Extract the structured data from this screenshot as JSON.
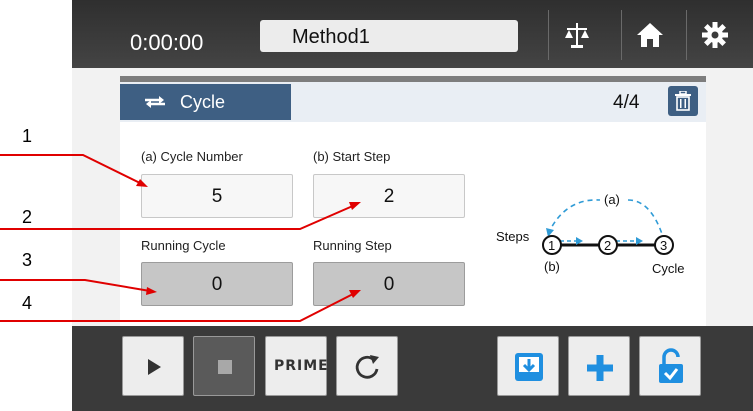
{
  "header": {
    "timer": "0:00:00",
    "method_name": "Method1"
  },
  "toolbar_icons": [
    "balance-icon",
    "home-icon",
    "gear-icon"
  ],
  "panel": {
    "tab_label": "Cycle",
    "counter": "4/4",
    "fields": {
      "cycle_number_label": "(a) Cycle Number",
      "cycle_number_value": "5",
      "start_step_label": "(b) Start Step",
      "start_step_value": "2",
      "running_cycle_label": "Running Cycle",
      "running_cycle_value": "0",
      "running_step_label": "Running Step",
      "running_step_value": "0"
    },
    "diagram": {
      "top_label": "(a)",
      "steps_label": "Steps",
      "start_label": "(b)",
      "cycle_label": "Cycle",
      "nodes": [
        "1",
        "2",
        "3"
      ]
    }
  },
  "bottom": {
    "prime_label": "PRIME"
  },
  "callouts": [
    "1",
    "2",
    "3",
    "4"
  ],
  "colors": {
    "accent": "#3e5f83",
    "callout_line": "#e00000",
    "diagram_arrow": "#2f9bd6",
    "icon_blue": "#1f8fe0"
  }
}
